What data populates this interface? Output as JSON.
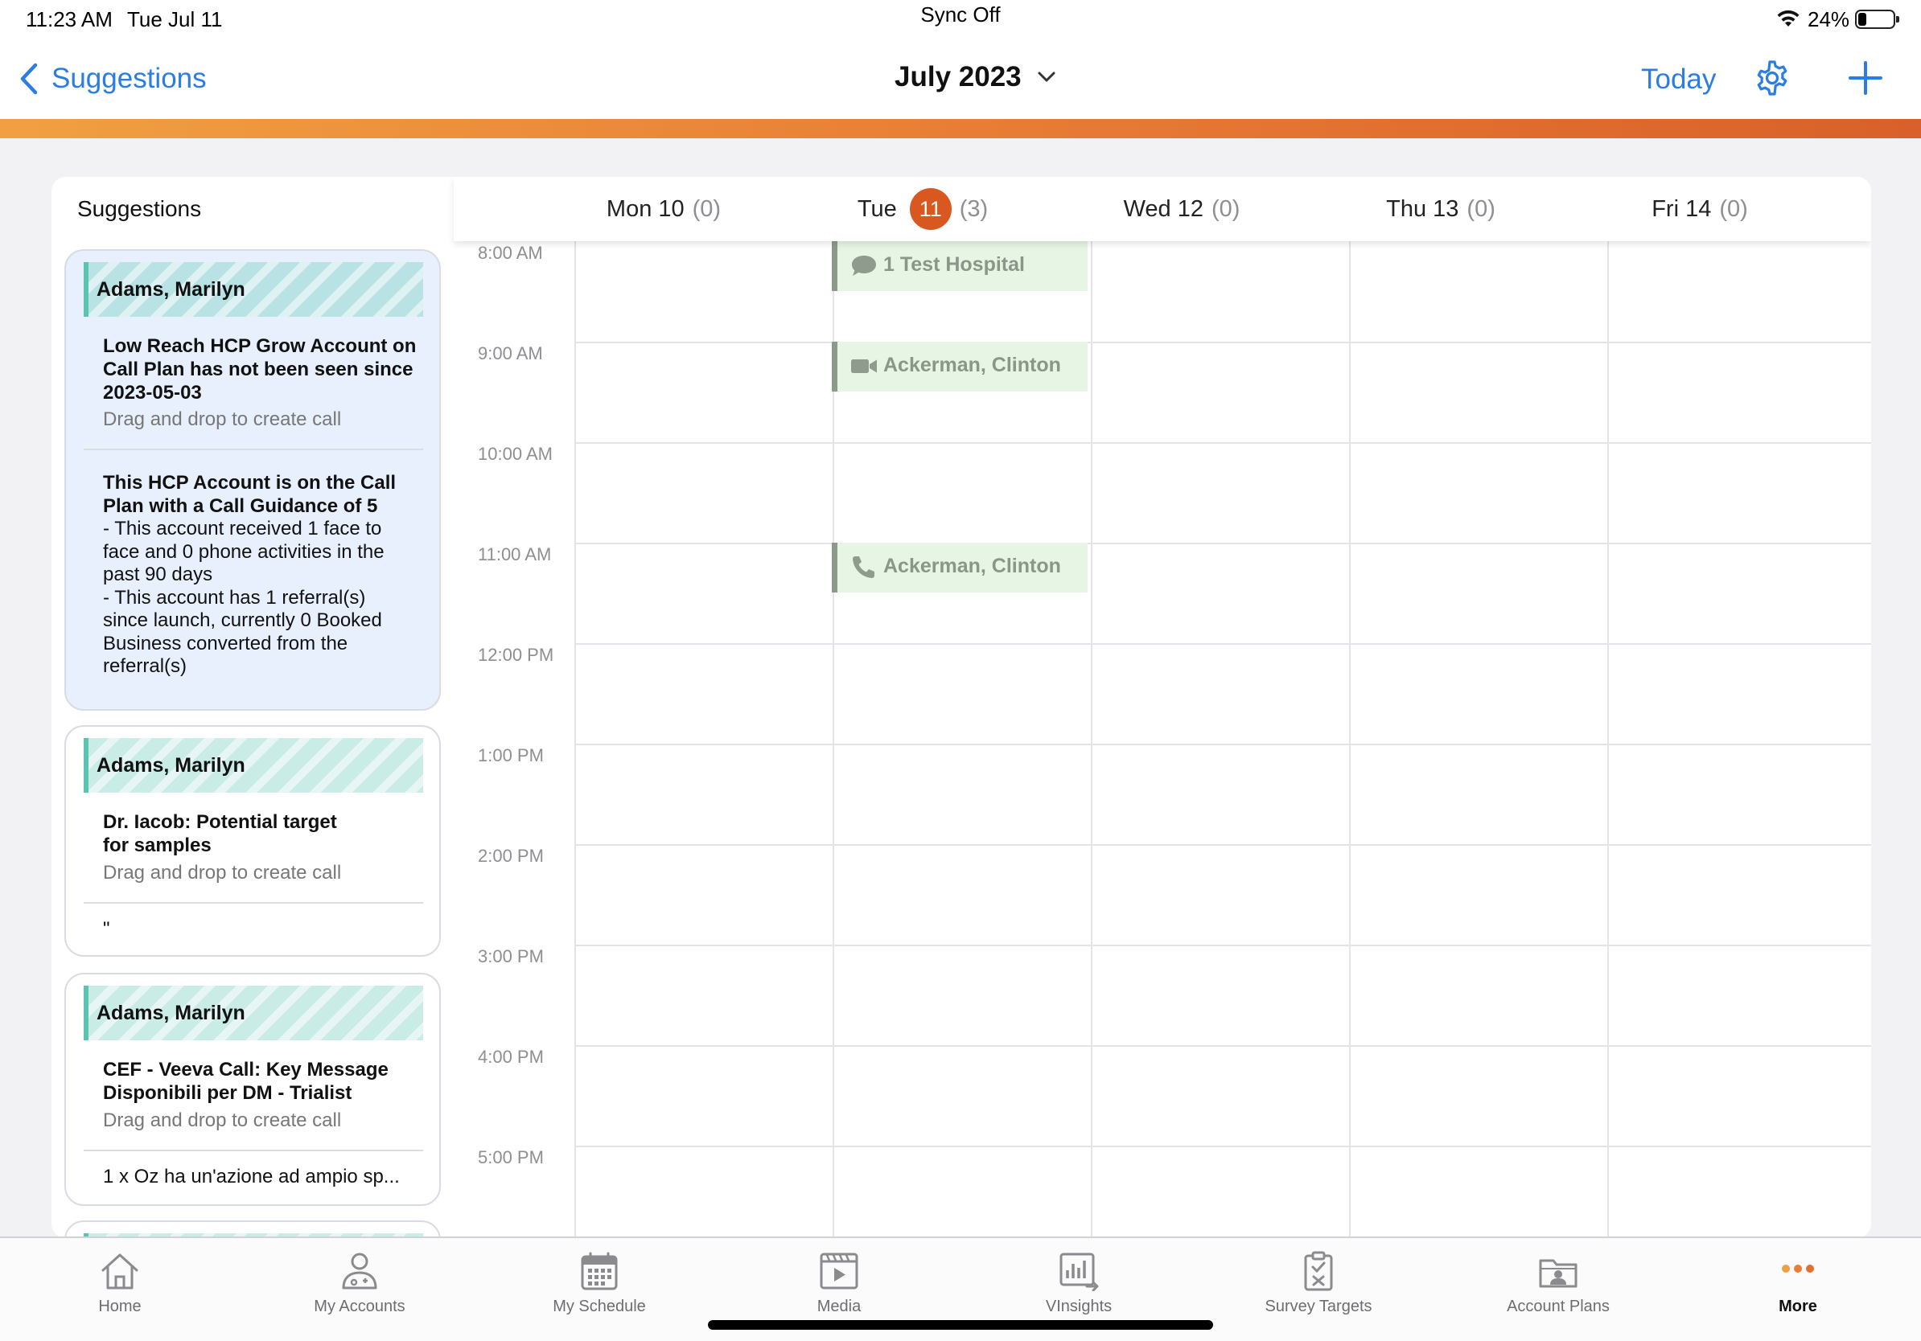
{
  "status_bar": {
    "time": "11:23 AM",
    "date": "Tue Jul 11",
    "sync": "Sync Off",
    "battery_pct": "24%",
    "battery_level": 0.24
  },
  "nav": {
    "back_label": "Suggestions",
    "title": "July 2023",
    "today_label": "Today",
    "icons": [
      "chevron-left-icon",
      "chevron-down-icon",
      "gear-icon",
      "plus-icon"
    ],
    "accent_color": "#2b7de4"
  },
  "accent_gradient": [
    "#f0a042",
    "#d9602a"
  ],
  "suggestions": {
    "header": "Suggestions",
    "items": [
      {
        "account": "Adams, Marilyn",
        "title_lines": [
          "Low Reach HCP Grow Account on",
          "Call Plan has not been seen since",
          "2023-05-03"
        ],
        "drag_hint": "Drag and drop to create call",
        "detail_title_lines": [
          "This HCP Account is on the Call",
          "Plan with a Call Guidance of 5"
        ],
        "detail_lines": [
          "- This account received 1 face to",
          "face and 0 phone activities in the",
          "past 90 days",
          "- This account has 1 referral(s)",
          "since launch, currently 0 Booked",
          "Business converted from the",
          "referral(s)"
        ]
      },
      {
        "account": "Adams, Marilyn",
        "title_lines": [
          "Dr. Iacob: Potential target",
          "for samples"
        ],
        "drag_hint": "Drag and drop to create call",
        "footer": "\""
      },
      {
        "account": "Adams, Marilyn",
        "title_lines": [
          "CEF - Veeva Call: Key Message",
          "Disponibili per DM - Trialist"
        ],
        "drag_hint": "Drag and drop to create call",
        "footer": "1 x Oz ha un'azione ad ampio sp..."
      }
    ]
  },
  "calendar": {
    "days": [
      {
        "label": "Mon 10",
        "count": "(0)"
      },
      {
        "label": "Tue",
        "badge": "11",
        "count": "(3)",
        "today": true
      },
      {
        "label": "Wed 12",
        "count": "(0)"
      },
      {
        "label": "Thu 13",
        "count": "(0)"
      },
      {
        "label": "Fri 14",
        "count": "(0)"
      }
    ],
    "today_color": "#d9581f",
    "times": [
      "8:00 AM",
      "9:00 AM",
      "10:00 AM",
      "11:00 AM",
      "12:00 PM",
      "1:00 PM",
      "2:00 PM",
      "3:00 PM",
      "4:00 PM",
      "5:00 PM"
    ],
    "events": [
      {
        "label": "1 Test Hospital",
        "icon": "chat-bubble-icon",
        "start": "8:00 AM",
        "duration_min": 30
      },
      {
        "label": "Ackerman, Clinton",
        "icon": "video-camera-icon",
        "start": "9:00 AM",
        "duration_min": 30
      },
      {
        "label": "Ackerman, Clinton",
        "icon": "phone-icon",
        "start": "11:00 AM",
        "duration_min": 30
      }
    ],
    "event_color": "#e6f5e4"
  },
  "tabs": [
    {
      "label": "Home",
      "icon": "home-icon"
    },
    {
      "label": "My Accounts",
      "icon": "person-icon"
    },
    {
      "label": "My Schedule",
      "icon": "calendar-icon"
    },
    {
      "label": "Media",
      "icon": "media-play-icon"
    },
    {
      "label": "VInsights",
      "icon": "insights-chart-icon"
    },
    {
      "label": "Survey Targets",
      "icon": "survey-clipboard-icon"
    },
    {
      "label": "Account Plans",
      "icon": "account-plans-folder-icon"
    },
    {
      "label": "More",
      "icon": "more-dots-icon",
      "active": true
    }
  ]
}
